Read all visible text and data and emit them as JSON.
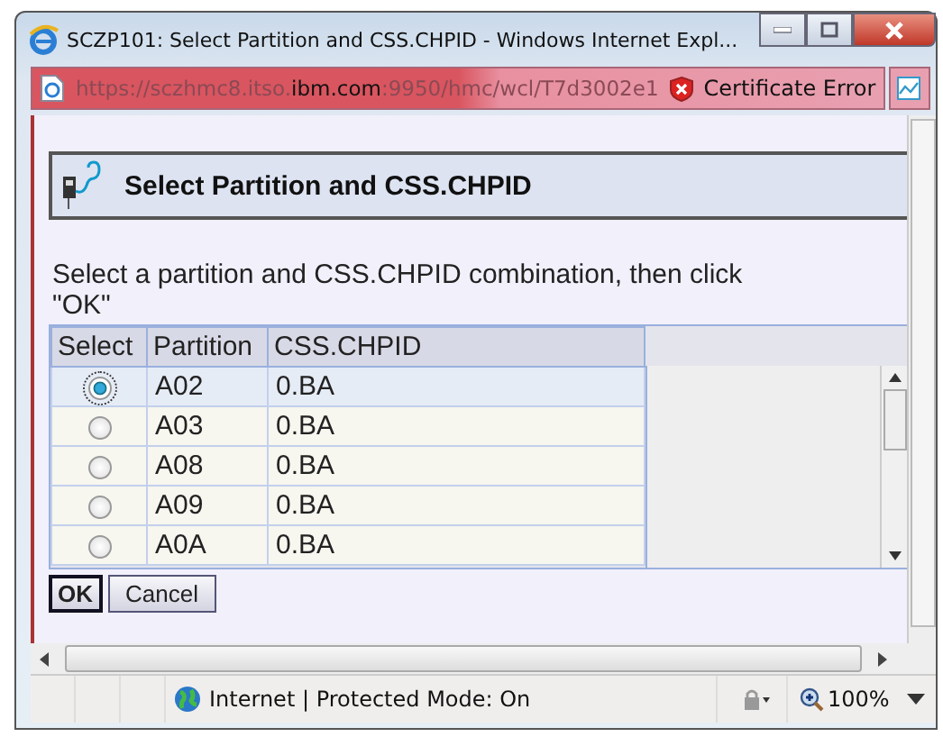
{
  "window": {
    "title": "SCZP101: Select Partition and CSS.CHPID - Windows Internet Expl..."
  },
  "address_bar": {
    "url": "https://sczhmc8.itso.**ibm.com**:9950/hmc/wcl/T7d3002e1",
    "security": "Certificate Error"
  },
  "panel": {
    "title": "Select Partition and CSS.CHPID"
  },
  "instructions": "Select a partition and CSS.CHPID combination, then click \"OK\"",
  "table": {
    "columns": [
      "Select",
      "Partition",
      "CSS.CHPID"
    ],
    "rows": [
      {
        "selected": true,
        "partition": "A02",
        "chpid": "0.BA"
      },
      {
        "selected": false,
        "partition": "A03",
        "chpid": "0.BA"
      },
      {
        "selected": false,
        "partition": "A08",
        "chpid": "0.BA"
      },
      {
        "selected": false,
        "partition": "A09",
        "chpid": "0.BA"
      },
      {
        "selected": false,
        "partition": "A0A",
        "chpid": "0.BA"
      }
    ]
  },
  "buttons": [
    {
      "label": "OK",
      "default": true
    },
    {
      "label": "Cancel",
      "default": false
    }
  ],
  "status_bar": {
    "zone": "Internet | Protected Mode: On",
    "zoom": "100%"
  }
}
